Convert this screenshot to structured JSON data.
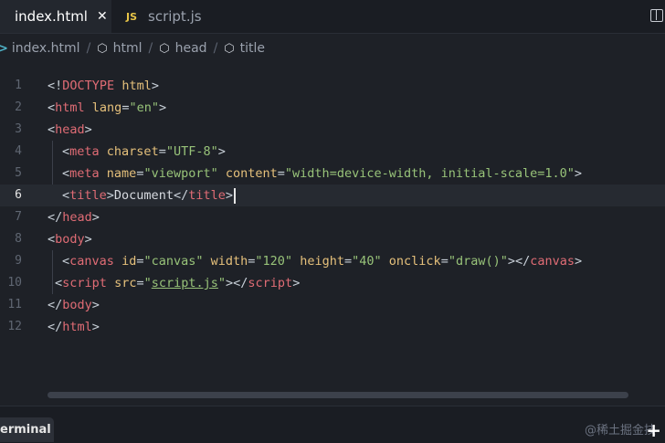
{
  "tabs": [
    {
      "label": "index.html",
      "active": true,
      "close": "✕"
    },
    {
      "label": "script.js",
      "active": false,
      "icon_text": "JS"
    }
  ],
  "breadcrumb": {
    "items": [
      "index.html",
      "html",
      "head",
      "title"
    ],
    "separator": "/"
  },
  "editor": {
    "current_line": 6,
    "line_numbers": [
      "1",
      "2",
      "3",
      "4",
      "5",
      "6",
      "7",
      "8",
      "9",
      "10",
      "11",
      "12"
    ]
  },
  "panel": {
    "terminal_label": "erminal",
    "watermark": "@稀土掘金技",
    "add_symbol": "+"
  },
  "colors": {
    "background": "#1e2127",
    "tag": "#e06c75",
    "attribute": "#e5c07b",
    "string": "#98c379"
  }
}
